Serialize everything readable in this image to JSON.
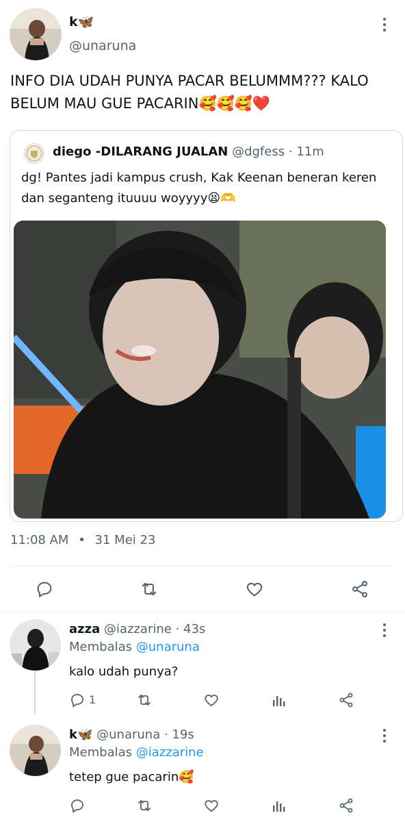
{
  "main_tweet": {
    "name": "k🦋",
    "handle": "@unaruna",
    "text": "INFO DIA UDAH PUNYA PACAR BELUMMM??? KALO BELUM MAU GUE PACARIN🥰🥰🥰❤️",
    "quote": {
      "name": "diego -DILARANG JUALAN",
      "handle": "@dgfess",
      "sep": "·",
      "time": "11m",
      "text": "dg! Pantes jadi kampus crush, Kak Keenan beneran keren dan seganteng ituuuu woyyyy😫🫶"
    },
    "time": "11:08 AM",
    "dot": "•",
    "date": "31 Mei 23"
  },
  "replies": [
    {
      "name": "azza",
      "handle": "@iazzarine",
      "sep": "·",
      "time": "43s",
      "replying_prefix": "Membalas",
      "replying_to": "@unaruna",
      "text": "kalo udah punya?",
      "reply_count": "1"
    },
    {
      "name": "k🦋",
      "handle": "@unaruna",
      "sep": "·",
      "time": "19s",
      "replying_prefix": "Membalas",
      "replying_to": "@iazzarine",
      "text": "tetep gue pacarin🥰"
    }
  ],
  "colors": {
    "accent": "#1d9bf0",
    "muted": "#536471",
    "text": "#0f1419",
    "border": "#cfd9de"
  },
  "icons": [
    "kebab-icon",
    "reply-icon",
    "retweet-icon",
    "like-icon",
    "share-icon",
    "views-icon"
  ]
}
